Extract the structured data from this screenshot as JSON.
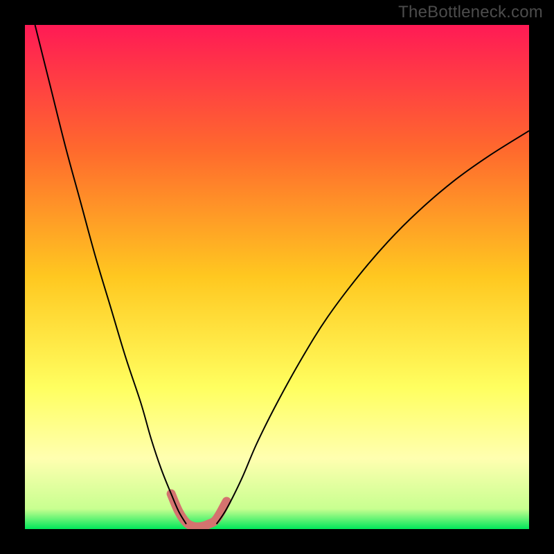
{
  "watermark": "TheBottleneck.com",
  "chart_data": {
    "type": "line",
    "title": "",
    "xlabel": "",
    "ylabel": "",
    "xlim": [
      0,
      100
    ],
    "ylim": [
      0,
      100
    ],
    "gradient": {
      "stops": [
        {
          "offset": 0,
          "color": "#ff1a55"
        },
        {
          "offset": 25,
          "color": "#ff6a2d"
        },
        {
          "offset": 50,
          "color": "#ffc820"
        },
        {
          "offset": 72,
          "color": "#ffff60"
        },
        {
          "offset": 86,
          "color": "#ffffb0"
        },
        {
          "offset": 96,
          "color": "#c8ff90"
        },
        {
          "offset": 100,
          "color": "#00e85a"
        }
      ]
    },
    "series": [
      {
        "name": "curve-left",
        "stroke": "#000000",
        "width": 2,
        "x": [
          2,
          5,
          8,
          11,
          14,
          17,
          20,
          23,
          25,
          27,
          29,
          30.5,
          32
        ],
        "y": [
          100,
          88,
          76,
          65,
          54,
          44,
          34,
          25,
          18,
          12,
          7,
          3.5,
          1
        ]
      },
      {
        "name": "curve-right",
        "stroke": "#000000",
        "width": 2,
        "x": [
          38,
          40,
          43,
          46,
          50,
          55,
          60,
          66,
          72,
          78,
          85,
          92,
          100
        ],
        "y": [
          1,
          4,
          10,
          17,
          25,
          34,
          42,
          50,
          57,
          63,
          69,
          74,
          79
        ]
      },
      {
        "name": "lowlight-U",
        "stroke": "#d4736f",
        "width": 13,
        "linecap": "round",
        "x": [
          29,
          30.5,
          32,
          33.5,
          35,
          36.5,
          38,
          40
        ],
        "y": [
          7,
          3.5,
          1.3,
          0.5,
          0.5,
          1.0,
          2.0,
          5.5
        ]
      }
    ]
  }
}
